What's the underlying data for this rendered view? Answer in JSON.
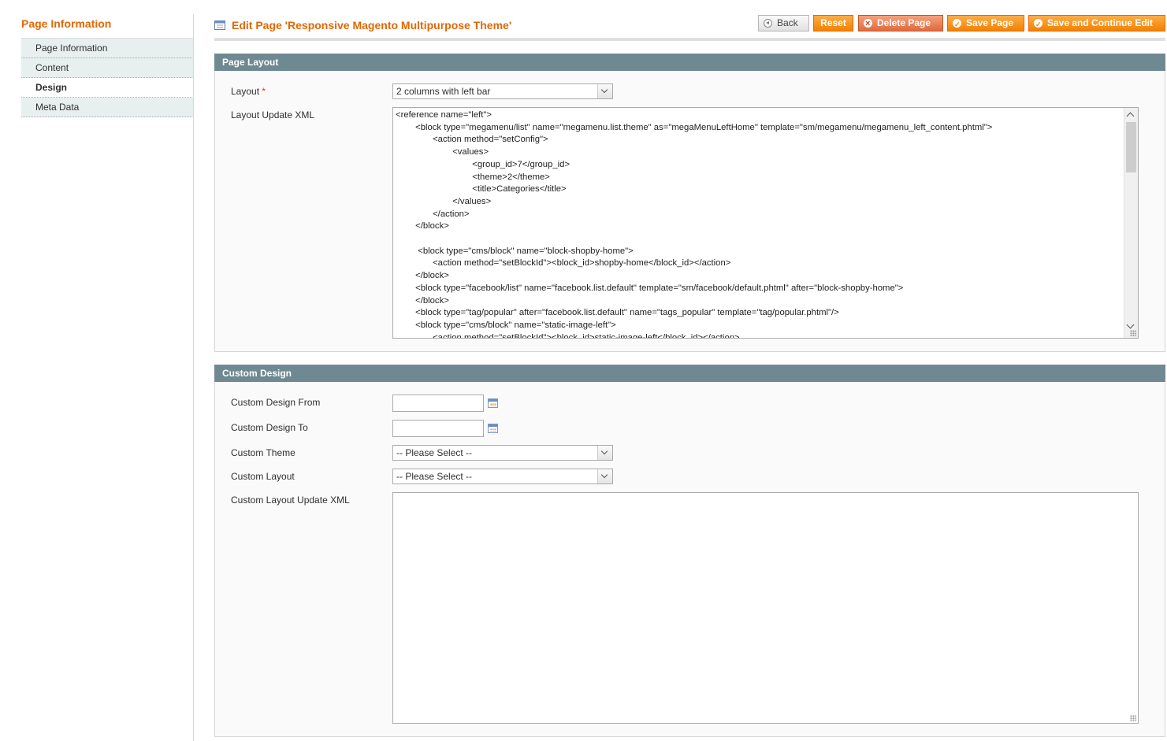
{
  "sidebar": {
    "title": "Page Information",
    "tabs": [
      {
        "label": "Page Information",
        "active": false
      },
      {
        "label": "Content",
        "active": false
      },
      {
        "label": "Design",
        "active": true
      },
      {
        "label": "Meta Data",
        "active": false
      }
    ]
  },
  "header": {
    "title": "Edit Page 'Responsive Magento Multipurpose Theme'",
    "buttons": {
      "back": "Back",
      "reset": "Reset",
      "delete": "Delete Page",
      "save": "Save Page",
      "save_continue": "Save and Continue Edit"
    }
  },
  "page_layout": {
    "section_title": "Page Layout",
    "layout_label": "Layout",
    "layout_required": "*",
    "layout_value": "2 columns with left bar",
    "xml_label": "Layout Update XML",
    "xml_value": "<reference name=\"left\">\n        <block type=\"megamenu/list\" name=\"megamenu.list.theme\" as=\"megaMenuLeftHome\" template=\"sm/megamenu/megamenu_left_content.phtml\">\n               <action method=\"setConfig\">\n                       <values>\n                               <group_id>7</group_id>\n                               <theme>2</theme>\n                               <title>Categories</title>\n                       </values>\n               </action>\n        </block>\n\n         <block type=\"cms/block\" name=\"block-shopby-home\">\n               <action method=\"setBlockId\"><block_id>shopby-home</block_id></action>\n        </block>\n        <block type=\"facebook/list\" name=\"facebook.list.default\" template=\"sm/facebook/default.phtml\" after=\"block-shopby-home\">\n        </block>\n        <block type=\"tag/popular\" after=\"facebook.list.default\" name=\"tags_popular\" template=\"tag/popular.phtml\"/>\n        <block type=\"cms/block\" name=\"static-image-left\">\n               <action method=\"setBlockId\"><block_id>static-image-left</block_id></action>"
  },
  "custom_design": {
    "section_title": "Custom Design",
    "from_label": "Custom Design From",
    "from_value": "",
    "to_label": "Custom Design To",
    "to_value": "",
    "theme_label": "Custom Theme",
    "theme_value": "-- Please Select --",
    "layout_label": "Custom Layout",
    "layout_value": "-- Please Select --",
    "xml_label": "Custom Layout Update XML",
    "xml_value": ""
  },
  "colors": {
    "accent": "#e26703",
    "section_header": "#6f8992",
    "button": "#f18200"
  }
}
